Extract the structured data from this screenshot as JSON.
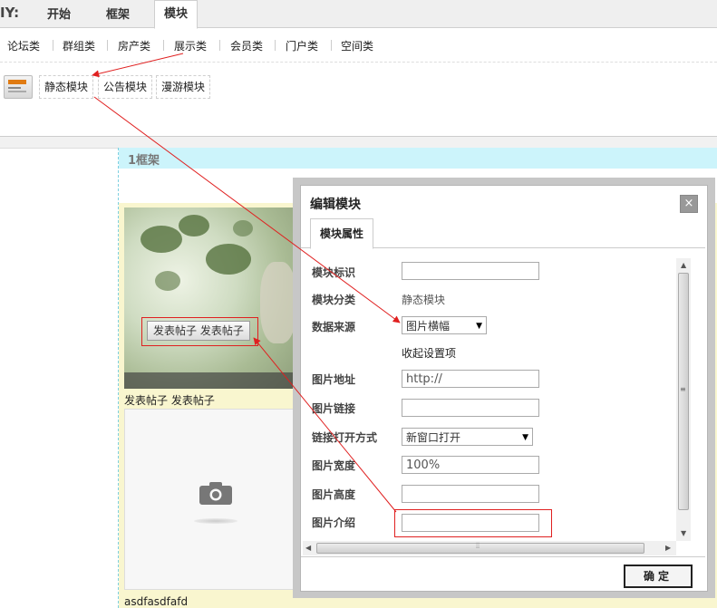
{
  "top_tabs": {
    "diy": "IY:",
    "items": [
      "开始",
      "框架",
      "模块"
    ],
    "active": "模块"
  },
  "categories": [
    "论坛类",
    "群组类",
    "房产类",
    "展示类",
    "会员类",
    "门户类",
    "空间类"
  ],
  "modules": [
    "静态模块",
    "公告模块",
    "漫游模块"
  ],
  "frame": {
    "label": "1框架"
  },
  "canvas": {
    "post_button": "发表帖子 发表帖子",
    "photo_caption": "发表帖子  发表帖子",
    "cell_caption": "asdfasdfafd"
  },
  "dialog": {
    "title": "编辑模块",
    "close": "×",
    "tab": "模块属性",
    "fields": {
      "id_label": "模块标识",
      "id_value": "",
      "category_label": "模块分类",
      "category_value": "静态模块",
      "source_label": "数据来源",
      "source_value": "图片横幅",
      "collapse_link": "收起设置项",
      "img_url_label": "图片地址",
      "img_url_value": "http://",
      "img_link_label": "图片链接",
      "img_link_value": "",
      "open_label": "链接打开方式",
      "open_value": "新窗口打开",
      "width_label": "图片宽度",
      "width_value": "100%",
      "height_label": "图片高度",
      "height_value": "",
      "desc_label": "图片介绍",
      "desc_value": ""
    },
    "ok": "确定"
  },
  "colors": {
    "annotation": "#e02020",
    "frame_header": "#ccf4fb",
    "canvas_bg": "#f9f6cf"
  }
}
